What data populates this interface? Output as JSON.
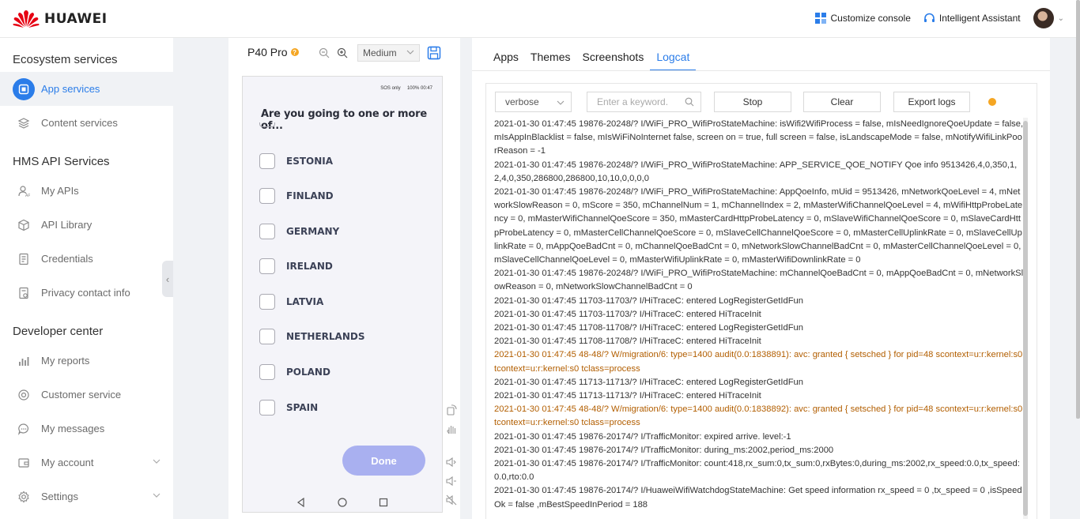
{
  "brand": {
    "name": "HUAWEI"
  },
  "header": {
    "customize_label": "Customize console",
    "assistant_label": "Intelligent Assistant"
  },
  "sidebar": {
    "ecosystem_title": "Ecosystem services",
    "ecosystem_items": [
      {
        "label": "App services",
        "icon": "app-services-icon",
        "active": true
      },
      {
        "label": "Content services",
        "icon": "layers-icon"
      }
    ],
    "hms_title": "HMS API Services",
    "hms_items": [
      {
        "label": "My APIs",
        "icon": "user-api-icon"
      },
      {
        "label": "API Library",
        "icon": "cube-icon"
      },
      {
        "label": "Credentials",
        "icon": "document-icon"
      },
      {
        "label": "Privacy contact info",
        "icon": "privacy-doc-icon"
      }
    ],
    "dev_title": "Developer center",
    "dev_items": [
      {
        "label": "My reports",
        "icon": "bar-chart-icon"
      },
      {
        "label": "Customer service",
        "icon": "headset-icon"
      },
      {
        "label": "My messages",
        "icon": "chat-icon"
      },
      {
        "label": "My account",
        "icon": "wallet-icon",
        "expandable": true
      },
      {
        "label": "Settings",
        "icon": "gear-icon",
        "expandable": true
      }
    ]
  },
  "device": {
    "model": "P40 Pro",
    "resolution": "Medium",
    "status_left": "SOS only",
    "status_right": "100%  00:47",
    "question": "Are you going to one or more of...",
    "options": [
      "ESTONIA",
      "FINLAND",
      "GERMANY",
      "IRELAND",
      "LATVIA",
      "NETHERLANDS",
      "POLAND",
      "SPAIN"
    ],
    "done_label": "Done"
  },
  "logcat": {
    "tabs": [
      "Apps",
      "Themes",
      "Screenshots",
      "Logcat"
    ],
    "active_tab": "Logcat",
    "level": "verbose",
    "keyword_placeholder": "Enter a keyword.",
    "stop_label": "Stop",
    "clear_label": "Clear",
    "export_label": "Export logs",
    "lines": [
      {
        "text": "2021-01-30 01:47:45 19876-20248/? I/WiFi_PRO_WifiProStateMachine: isWifi2WifiProcess = false, mIsNeedIgnoreQoeUpdate = false, mIsAppInBlacklist = false, mIsWiFiNoInternet false, screen on = true, full screen = false, isLandscapeMode = false, mNotifyWifiLinkPoorReason = -1",
        "warn": false
      },
      {
        "text": "2021-01-30 01:47:45 19876-20248/? I/WiFi_PRO_WifiProStateMachine: APP_SERVICE_QOE_NOTIFY Qoe info 9513426,4,0,350,1,2,4,0,350,286800,286800,10,10,0,0,0,0",
        "warn": false
      },
      {
        "text": "2021-01-30 01:47:45 19876-20248/? I/WiFi_PRO_WifiProStateMachine: AppQoeInfo, mUid = 9513426, mNetworkQoeLevel = 4, mNetworkSlowReason = 0, mScore = 350, mChannelNum = 1, mChannelIndex = 2, mMasterWifiChannelQoeLevel = 4, mWifiHttpProbeLatency = 0, mMasterWifiChannelQoeScore = 350, mMasterCardHttpProbeLatency = 0, mSlaveWifiChannelQoeScore = 0, mSlaveCardHttpProbeLatency = 0, mMasterCellChannelQoeScore = 0, mSlaveCellChannelQoeScore = 0, mMasterCellUplinkRate = 0, mSlaveCellUplinkRate = 0, mAppQoeBadCnt = 0, mChannelQoeBadCnt = 0, mNetworkSlowChannelBadCnt = 0, mMasterCellChannelQoeLevel = 0, mSlaveCellChannelQoeLevel = 0, mMasterWifiUplinkRate = 0, mMasterWifiDownlinkRate = 0",
        "warn": false
      },
      {
        "text": "2021-01-30 01:47:45 19876-20248/? I/WiFi_PRO_WifiProStateMachine: mChannelQoeBadCnt = 0, mAppQoeBadCnt = 0, mNetworkSlowReason = 0, mNetworkSlowChannelBadCnt = 0",
        "warn": false
      },
      {
        "text": "2021-01-30 01:47:45 11703-11703/? I/HiTraceC: entered LogRegisterGetIdFun",
        "warn": false
      },
      {
        "text": "2021-01-30 01:47:45 11703-11703/? I/HiTraceC: entered HiTraceInit",
        "warn": false
      },
      {
        "text": "2021-01-30 01:47:45 11708-11708/? I/HiTraceC: entered LogRegisterGetIdFun",
        "warn": false
      },
      {
        "text": "2021-01-30 01:47:45 11708-11708/? I/HiTraceC: entered HiTraceInit",
        "warn": false
      },
      {
        "text": "2021-01-30 01:47:45 48-48/? W/migration/6: type=1400 audit(0.0:1838891): avc: granted { setsched } for pid=48 scontext=u:r:kernel:s0 tcontext=u:r:kernel:s0 tclass=process",
        "warn": true
      },
      {
        "text": "2021-01-30 01:47:45 11713-11713/? I/HiTraceC: entered LogRegisterGetIdFun",
        "warn": false
      },
      {
        "text": "2021-01-30 01:47:45 11713-11713/? I/HiTraceC: entered HiTraceInit",
        "warn": false
      },
      {
        "text": "2021-01-30 01:47:45 48-48/? W/migration/6: type=1400 audit(0.0:1838892): avc: granted { setsched } for pid=48 scontext=u:r:kernel:s0 tcontext=u:r:kernel:s0 tclass=process",
        "warn": true
      },
      {
        "text": "2021-01-30 01:47:45 19876-20174/? I/TrafficMonitor: expired arrive. level:-1",
        "warn": false
      },
      {
        "text": "2021-01-30 01:47:45 19876-20174/? I/TrafficMonitor: during_ms:2002,period_ms:2000",
        "warn": false
      },
      {
        "text": "2021-01-30 01:47:45 19876-20174/? I/TrafficMonitor: count:418,rx_sum:0,tx_sum:0,rxBytes:0,during_ms:2002,rx_speed:0.0,tx_speed:0.0,rto:0.0",
        "warn": false
      },
      {
        "text": "2021-01-30 01:47:45 19876-20174/? I/HuaweiWifiWatchdogStateMachine: Get speed information rx_speed = 0 ,tx_speed = 0 ,isSpeedOk = false ,mBestSpeedInPeriod = 188",
        "warn": false
      }
    ]
  },
  "colors": {
    "accent": "#2b7de9",
    "warn": "#b25e00",
    "done": "#a9b0f0",
    "badge": "#f5a623"
  }
}
